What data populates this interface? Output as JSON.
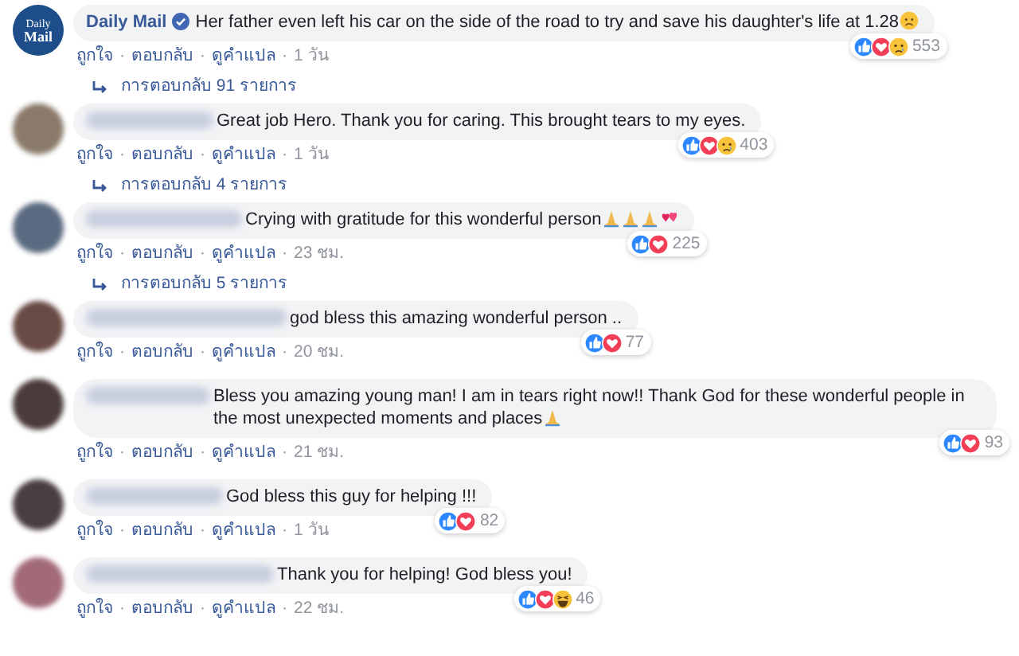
{
  "separator": "·",
  "comments": [
    {
      "author": "Daily Mail",
      "verified": true,
      "avatar": {
        "kind": "logo",
        "lines": [
          "Daily",
          "Mail"
        ]
      },
      "text": "Her father even left his car on the side of the road to try and save his daughter's life at 1.28",
      "emoji": [
        {
          "kind": "worried"
        }
      ],
      "reactions": [
        {
          "kind": "like"
        },
        {
          "kind": "love"
        },
        {
          "kind": "sad"
        }
      ],
      "reaction_count": "553",
      "actions": [
        "ถูกใจ",
        "ตอบกลับ",
        "ดูคำแปล"
      ],
      "time": "1 วัน",
      "replies": "การตอบกลับ 91 รายการ"
    },
    {
      "avatar": {
        "kind": "photo"
      },
      "text": "Great job Hero. Thank you for caring. This brought tears to my eyes.",
      "reactions": [
        {
          "kind": "like"
        },
        {
          "kind": "love"
        },
        {
          "kind": "sad"
        }
      ],
      "reaction_count": "403",
      "actions": [
        "ถูกใจ",
        "ตอบกลับ",
        "ดูคำแปล"
      ],
      "time": "1 วัน",
      "replies": "การตอบกลับ 4 รายการ"
    },
    {
      "avatar": {
        "kind": "photo"
      },
      "text": "Crying with gratitude for this wonderful person",
      "emoji": [
        {
          "kind": "pray"
        },
        {
          "kind": "pray"
        },
        {
          "kind": "pray"
        },
        {
          "kind": "hearts"
        }
      ],
      "reactions": [
        {
          "kind": "like"
        },
        {
          "kind": "love"
        }
      ],
      "reaction_count": "225",
      "actions": [
        "ถูกใจ",
        "ตอบกลับ",
        "ดูคำแปล"
      ],
      "time": "23 ชม.",
      "replies": "การตอบกลับ 5 รายการ"
    },
    {
      "avatar": {
        "kind": "photo"
      },
      "text": "god bless this amazing wonderful person ..",
      "reactions": [
        {
          "kind": "like"
        },
        {
          "kind": "love"
        }
      ],
      "reaction_count": "77",
      "actions": [
        "ถูกใจ",
        "ตอบกลับ",
        "ดูคำแปล"
      ],
      "time": "20 ชม."
    },
    {
      "avatar": {
        "kind": "photo"
      },
      "text": "Bless you amazing young man! I am in tears right now!! Thank God for these wonderful people in the most unexpected moments and places",
      "emoji": [
        {
          "kind": "pray"
        }
      ],
      "reactions": [
        {
          "kind": "like"
        },
        {
          "kind": "love"
        }
      ],
      "reaction_count": "93",
      "actions": [
        "ถูกใจ",
        "ตอบกลับ",
        "ดูคำแปล"
      ],
      "time": "21 ชม."
    },
    {
      "avatar": {
        "kind": "photo"
      },
      "text": "God bless this guy for helping !!!",
      "reactions": [
        {
          "kind": "like"
        },
        {
          "kind": "love"
        }
      ],
      "reaction_count": "82",
      "actions": [
        "ถูกใจ",
        "ตอบกลับ",
        "ดูคำแปล"
      ],
      "time": "1 วัน"
    },
    {
      "avatar": {
        "kind": "photo"
      },
      "text": "Thank you for helping! God bless you!",
      "reactions": [
        {
          "kind": "like"
        },
        {
          "kind": "love"
        },
        {
          "kind": "haha"
        }
      ],
      "reaction_count": "46",
      "actions": [
        "ถูกใจ",
        "ตอบกลับ",
        "ดูคำแปล"
      ],
      "time": "22 ชม."
    }
  ]
}
